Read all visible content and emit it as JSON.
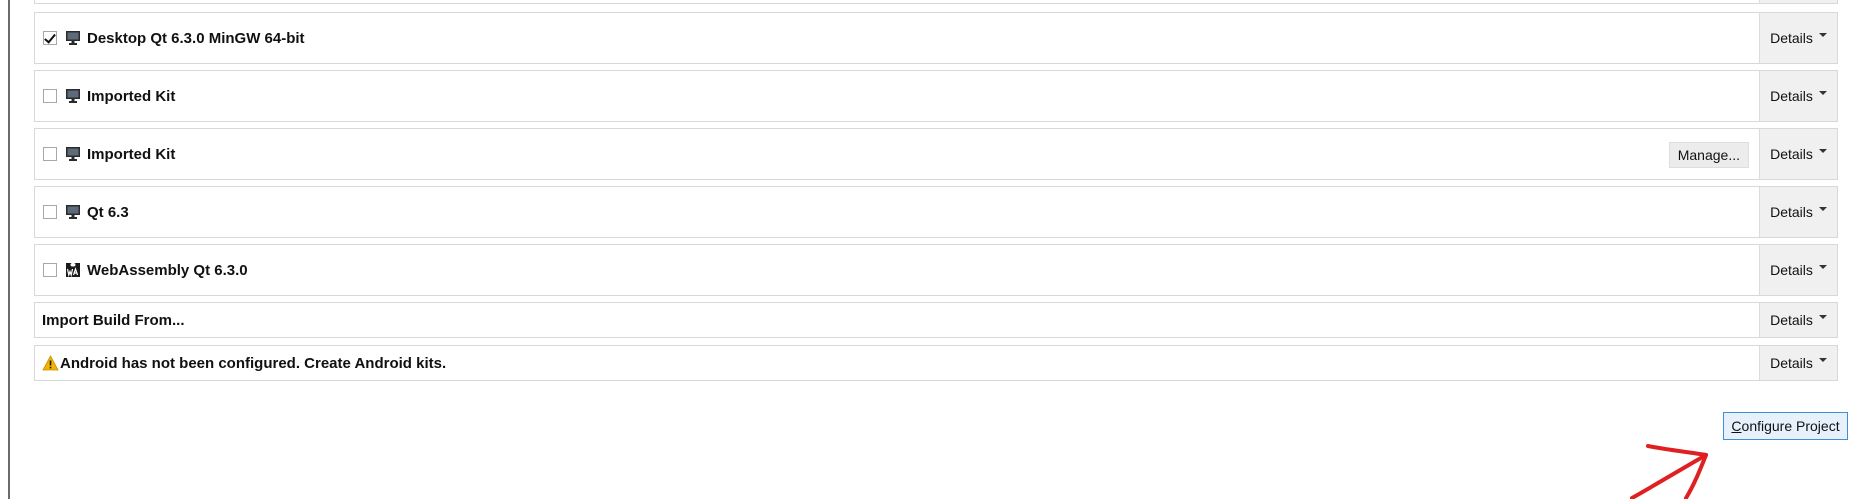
{
  "kits": [
    {
      "name": "Desktop Qt 6.3.0 MinGW 64-bit",
      "checked": true,
      "icon": "desktop-monitor-icon",
      "details_label": "Details"
    },
    {
      "name": "Imported Kit",
      "checked": false,
      "icon": "desktop-monitor-icon",
      "details_label": "Details"
    },
    {
      "name": "Imported Kit",
      "checked": false,
      "icon": "desktop-monitor-icon",
      "details_label": "Details",
      "manage_label": "Manage..."
    },
    {
      "name": "Qt 6.3",
      "checked": false,
      "icon": "desktop-monitor-icon",
      "details_label": "Details"
    },
    {
      "name": "WebAssembly Qt 6.3.0",
      "checked": false,
      "icon": "webassembly-icon",
      "details_label": "Details"
    }
  ],
  "import_build": {
    "label": "Import Build From...",
    "details_label": "Details"
  },
  "android_warning": {
    "label": "Android has not been configured. Create Android kits.",
    "icon": "warning-icon",
    "details_label": "Details"
  },
  "configure_project": {
    "mnemonic": "C",
    "rest": "onfigure Project"
  },
  "colors": {
    "accent_border": "#3f8fd7",
    "button_bg": "#e6f1fb",
    "warning": "#f2b400",
    "annotation_arrow": "#e02020"
  }
}
